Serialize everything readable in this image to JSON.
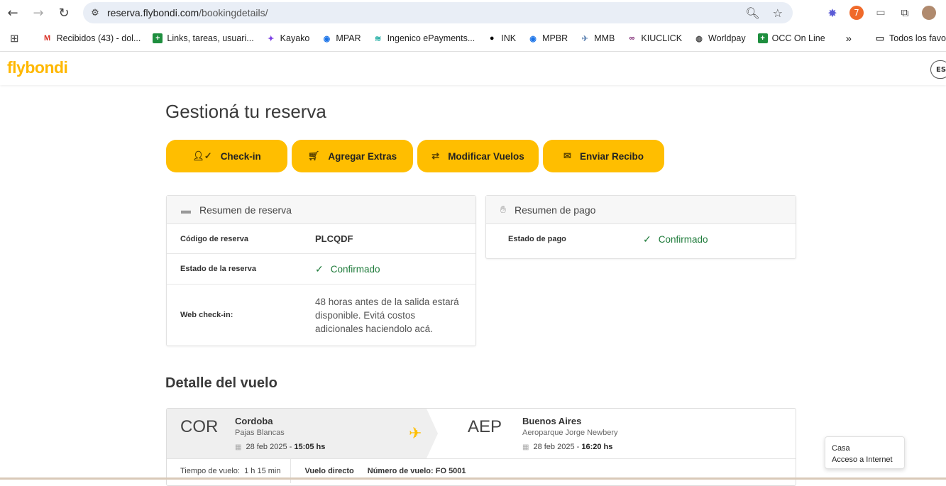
{
  "browser": {
    "url_host": "reserva.flybondi.com",
    "url_path": "/bookingdetails/",
    "bookmarks": [
      {
        "label": "Recibidos (43) - dol...",
        "icon": "gmail-icon"
      },
      {
        "label": "Links, tareas, usuari...",
        "icon": "sheets-icon"
      },
      {
        "label": "Kayako",
        "icon": "kayako-icon"
      },
      {
        "label": "MPAR",
        "icon": "mpar-icon"
      },
      {
        "label": "Ingenico ePayments...",
        "icon": "ingenico-icon"
      },
      {
        "label": "INK",
        "icon": "ink-icon"
      },
      {
        "label": "MPBR",
        "icon": "mpbr-icon"
      },
      {
        "label": "MMB",
        "icon": "mmb-icon"
      },
      {
        "label": "KIUCLICK",
        "icon": "kiuclick-icon"
      },
      {
        "label": "Worldpay",
        "icon": "globe-icon"
      },
      {
        "label": "OCC On Line",
        "icon": "sheets-icon"
      }
    ],
    "all_bookmarks": "Todos los favori"
  },
  "site": {
    "logo": "flybondi",
    "lang": "ES"
  },
  "page": {
    "title": "Gestioná tu reserva",
    "actions": [
      {
        "label": "Check-in",
        "icon": "user-check-icon"
      },
      {
        "label": "Agregar Extras",
        "icon": "cart-icon"
      },
      {
        "label": "Modificar Vuelos",
        "icon": "swap-icon"
      },
      {
        "label": "Enviar Recibo",
        "icon": "envelope-icon"
      }
    ]
  },
  "booking_summary": {
    "title": "Resumen de reserva",
    "code_label": "Código de reserva",
    "code_value": "PLCQDF",
    "status_label": "Estado de la reserva",
    "status_value": "Confirmado",
    "checkin_label": "Web check-in:",
    "checkin_text": "48 horas antes de la salida estará disponible. Evitá costos adicionales haciendolo acá."
  },
  "payment_summary": {
    "title": "Resumen de pago",
    "status_label": "Estado de pago",
    "status_value": "Confirmado"
  },
  "flight": {
    "section_title": "Detalle del vuelo",
    "origin": {
      "iata": "COR",
      "city": "Cordoba",
      "airport": "Pajas Blancas",
      "date": "28 feb 2025 - ",
      "time": "15:05 hs"
    },
    "destination": {
      "iata": "AEP",
      "city": "Buenos Aires",
      "airport": "Aeroparque Jorge Newbery",
      "date": "28 feb 2025 - ",
      "time": "16:20 hs"
    },
    "duration_label": "Tiempo de vuelo:",
    "duration_value": "1 h 15 min",
    "direct": "Vuelo directo",
    "number_label": "Número de vuelo:",
    "number_value": "FO 5001"
  },
  "tooltip": {
    "line1": "Casa",
    "line2": "Acceso a Internet"
  }
}
